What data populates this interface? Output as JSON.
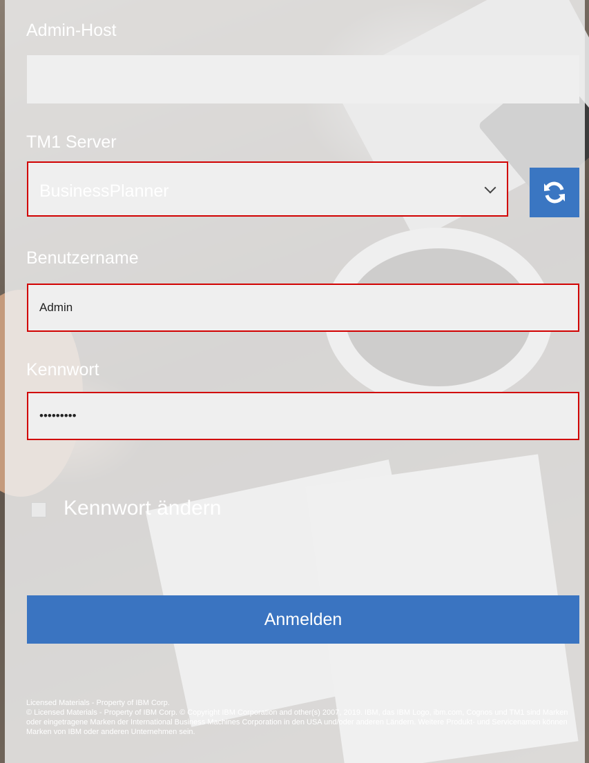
{
  "form": {
    "admin_host_label": "Admin-Host",
    "admin_host_value": "",
    "tm1_server_label": "TM1 Server",
    "tm1_server_value": "BusinessPlanner",
    "refresh_icon": "refresh-icon",
    "username_label": "Benutzername",
    "username_value": "Admin",
    "password_label": "Kennwort",
    "password_value": "•••••••••",
    "change_password_label": "Kennwort ändern",
    "login_button": "Anmelden"
  },
  "footer": {
    "line1": "Licensed Materials - Property of IBM Corp.",
    "line2": "© Licensed Materials - Property of IBM Corp. © Copyright IBM Corporation and other(s) 2007, 2019. IBM, das IBM Logo, ibm.com, Cognos und TM1 sind Marken oder eingetragene Marken der International Business Machines Corporation in den USA und/oder anderen Ländern. Weitere Produkt- und Servicenamen können Marken von IBM oder anderen Unternehmen sein."
  },
  "colors": {
    "primary_blue": "#3a74c1",
    "highlight_red": "#d10000"
  }
}
